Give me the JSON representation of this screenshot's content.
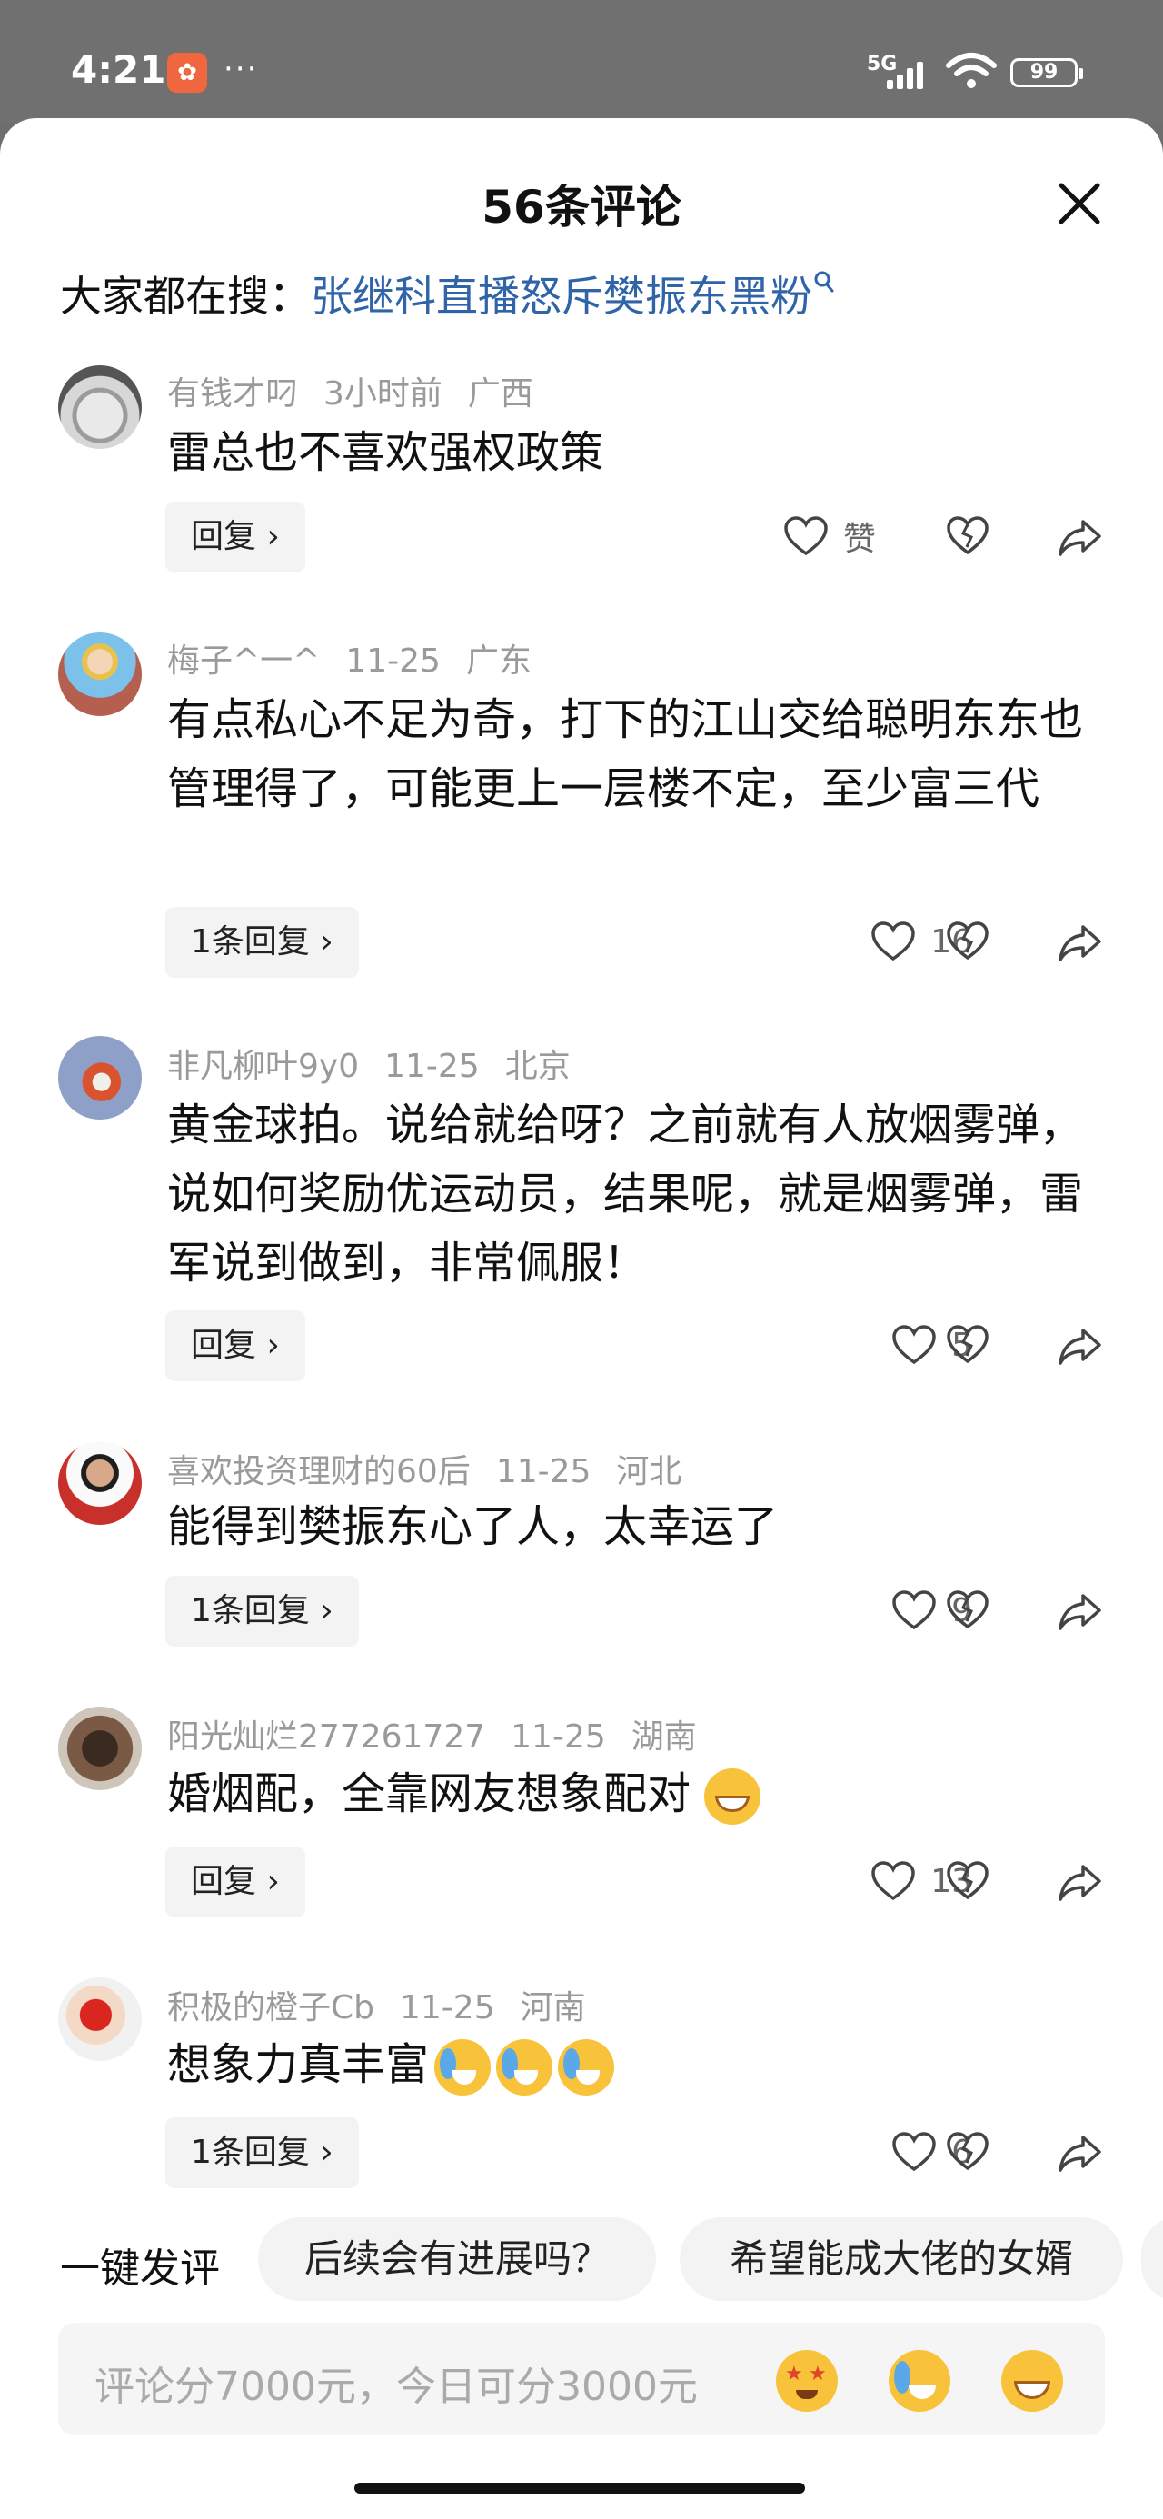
{
  "status_bar": {
    "time": "4:21",
    "app_icon": "app-badge-icon",
    "dots": "···",
    "network": "5G",
    "battery": "99"
  },
  "sheet": {
    "title": "56条评论"
  },
  "search": {
    "prefix": "大家都在搜：",
    "keyword": "张继科直播怒斥樊振东黑粉",
    "icon": "search-icon"
  },
  "comments": [
    {
      "user": "有钱才叼",
      "time": "3小时前",
      "region": "广西",
      "text": "雷总也不喜欢强权政策",
      "reply": "回复 ›",
      "likes": "赞"
    },
    {
      "user": "梅子^一^",
      "time": "11-25",
      "region": "广东",
      "text": "有点私心不足为奇，打下的江山交给聪明东东也管理得了，可能更上一层楼不定，至少富三代",
      "reply": "1条回复 ›",
      "likes": "16"
    },
    {
      "user": "非凡柳叶9y0",
      "time": "11-25",
      "region": "北京",
      "text": "黄金球拍。说给就给呀？之前就有人放烟雾弹，说如何奖励优运动员，结果呢，就是烟雾弹，雷军说到做到，非常佩服！",
      "reply": "回复 ›",
      "likes": "5"
    },
    {
      "user": "喜欢投资理财的60后",
      "time": "11-25",
      "region": "河北",
      "text": "能得到樊振东心了人，太幸运了",
      "reply": "1条回复 ›",
      "likes": "9"
    },
    {
      "user": "阳光灿烂277261727",
      "time": "11-25",
      "region": "湖南",
      "text": "婚烟配，全靠网友想象配对",
      "reply": "回复 ›",
      "likes": "13"
    },
    {
      "user": "积极的橙子Cb",
      "time": "11-25",
      "region": "河南",
      "text": "想象力真丰富",
      "reply": "1条回复 ›",
      "likes": "6"
    }
  ],
  "quick_replies": {
    "label": "一键发评",
    "chips": [
      "后续会有进展吗？",
      "希望能成大佬的女婿"
    ]
  },
  "input": {
    "placeholder": "评论分7000元，今日可分3000元"
  }
}
